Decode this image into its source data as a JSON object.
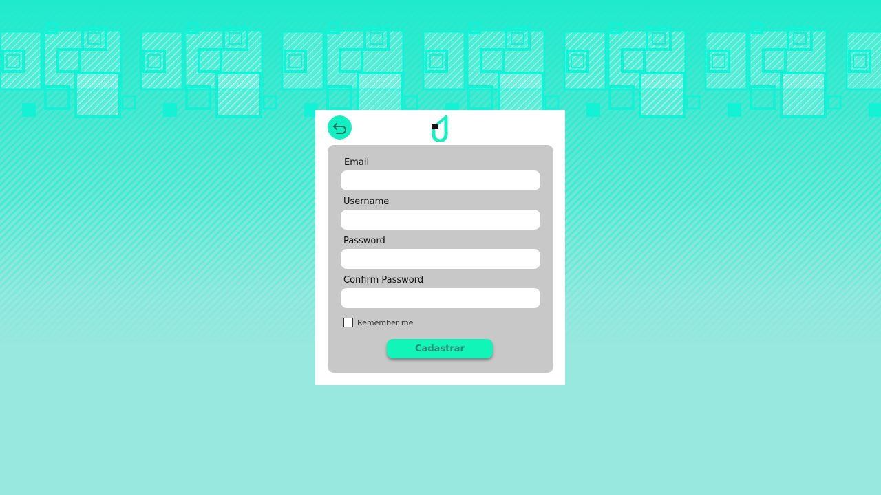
{
  "colors": {
    "accent": "#12f0c2",
    "button": "#12f5b8",
    "button_text": "#2a8a74",
    "panel": "#c8c8c8",
    "background": "#98e8df"
  },
  "back_button": {
    "icon": "undo-arrow-icon"
  },
  "logo": {
    "icon": "brand-logo-icon"
  },
  "form": {
    "fields": [
      {
        "label": "Email",
        "value": "",
        "placeholder": ""
      },
      {
        "label": "Username",
        "value": "",
        "placeholder": ""
      },
      {
        "label": "Password",
        "value": "",
        "placeholder": ""
      },
      {
        "label": "Confirm Password",
        "value": "",
        "placeholder": ""
      }
    ],
    "remember_label": "Remember me",
    "remember_checked": false,
    "submit_label": "Cadastrar"
  }
}
